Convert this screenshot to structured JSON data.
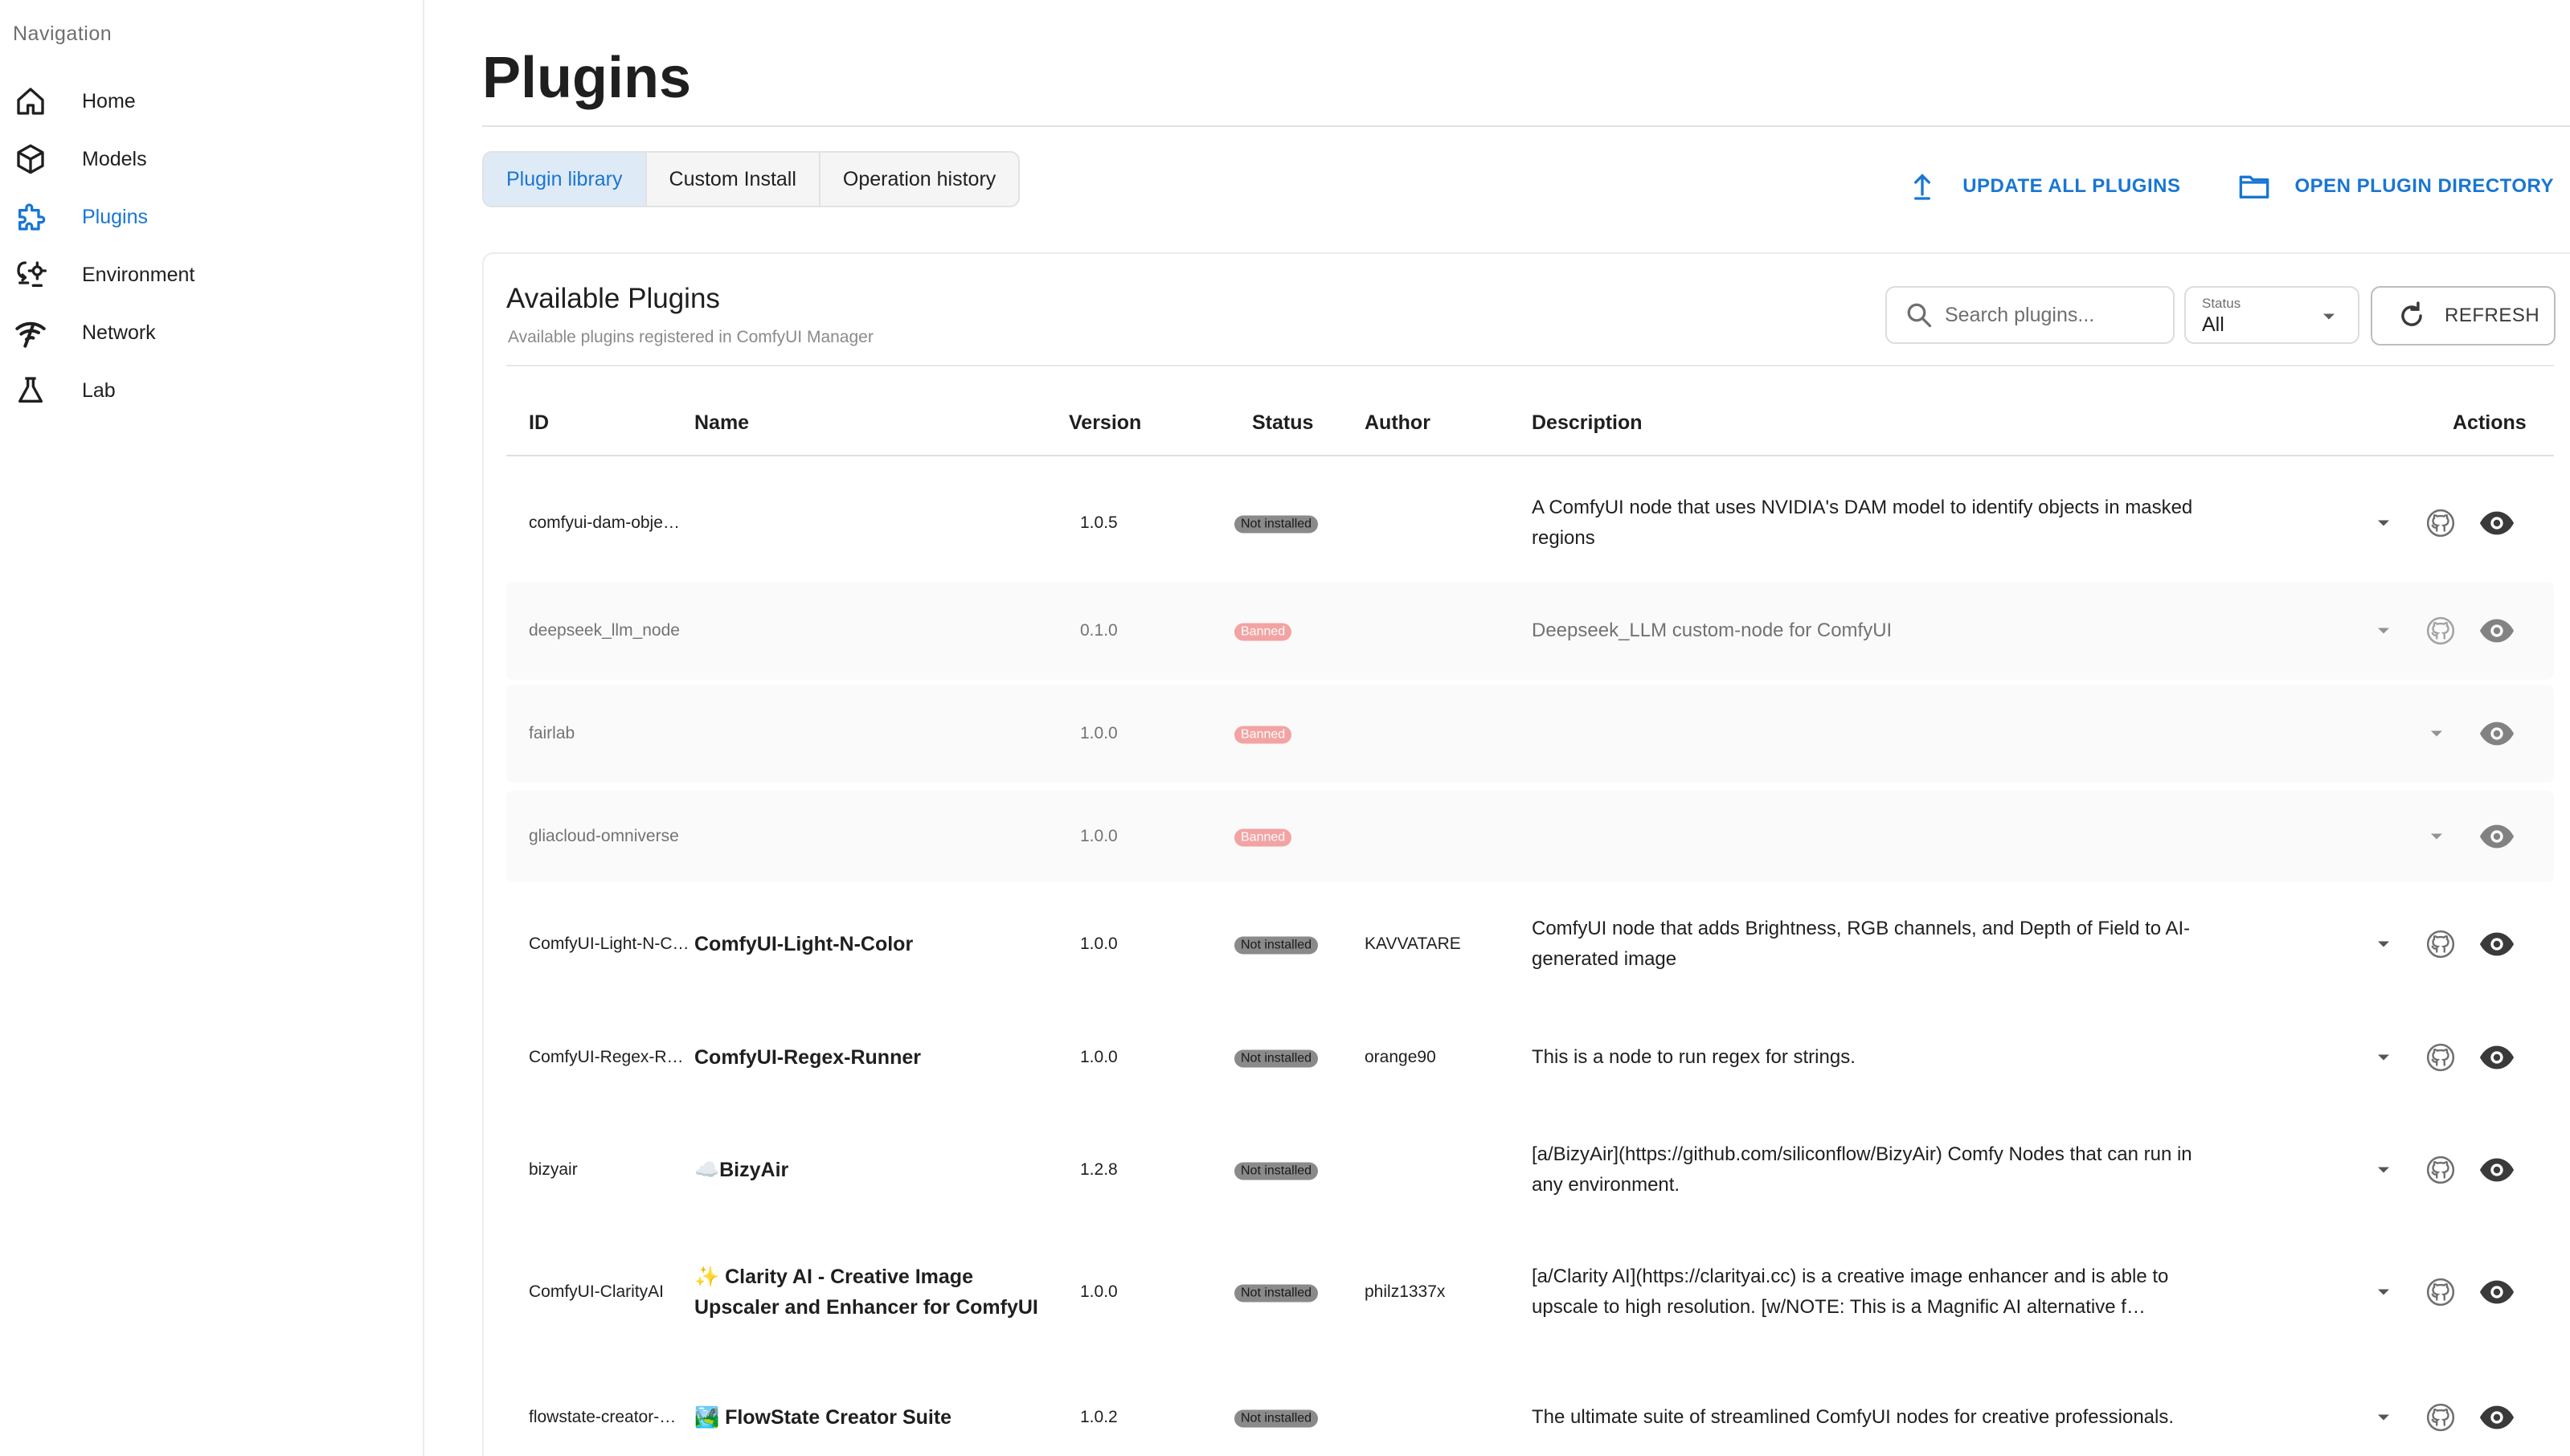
{
  "sidebar": {
    "heading": "Navigation",
    "items": [
      {
        "label": "Home",
        "icon": "home-icon"
      },
      {
        "label": "Models",
        "icon": "cube-icon"
      },
      {
        "label": "Plugins",
        "icon": "puzzle-icon",
        "active": true
      },
      {
        "label": "Environment",
        "icon": "environment-icon"
      },
      {
        "label": "Network",
        "icon": "network-icon"
      },
      {
        "label": "Lab",
        "icon": "flask-icon"
      }
    ]
  },
  "page": {
    "title": "Plugins"
  },
  "tabs": [
    {
      "label": "Plugin library",
      "active": true
    },
    {
      "label": "Custom Install"
    },
    {
      "label": "Operation history"
    }
  ],
  "actions": {
    "update_all": "UPDATE ALL PLUGINS",
    "open_dir": "OPEN PLUGIN DIRECTORY"
  },
  "card": {
    "title": "Available Plugins",
    "subtitle": "Available plugins registered in ComfyUI Manager",
    "search_placeholder": "Search plugins...",
    "status_label": "Status",
    "status_value": "All",
    "refresh": "REFRESH"
  },
  "table": {
    "headers": {
      "id": "ID",
      "name": "Name",
      "version": "Version",
      "status": "Status",
      "author": "Author",
      "description": "Description",
      "actions": "Actions"
    },
    "rows": [
      {
        "id": "comfyui-dam-obje…",
        "name": "",
        "version": "1.0.5",
        "status": "Not installed",
        "author": "",
        "description": "A ComfyUI node that uses NVIDIA's DAM model to identify objects in masked regions",
        "banned": false
      },
      {
        "id": "deepseek_llm_node",
        "name": "",
        "version": "0.1.0",
        "status": "Banned",
        "author": "",
        "description": "Deepseek_LLM custom-node for ComfyUI",
        "banned": true,
        "github": true
      },
      {
        "id": "fairlab",
        "name": "",
        "version": "1.0.0",
        "status": "Banned",
        "author": "",
        "description": "",
        "banned": true,
        "github": false
      },
      {
        "id": "gliacloud-omniverse",
        "name": "",
        "version": "1.0.0",
        "status": "Banned",
        "author": "",
        "description": "",
        "banned": true,
        "github": false
      },
      {
        "id": "ComfyUI-Light-N-C…",
        "name": "ComfyUI-Light-N-Color",
        "version": "1.0.0",
        "status": "Not installed",
        "author": "KAVVATARE",
        "description": "ComfyUI node that adds Brightness, RGB channels, and Depth of Field to AI-generated image",
        "banned": false
      },
      {
        "id": "ComfyUI-Regex-Ru…",
        "name": "ComfyUI-Regex-Runner",
        "version": "1.0.0",
        "status": "Not installed",
        "author": "orange90",
        "description": "This is a node to run regex for strings.",
        "banned": false
      },
      {
        "id": "bizyair",
        "name": "☁️BizyAir",
        "version": "1.2.8",
        "status": "Not installed",
        "author": "",
        "description": "[a/BizyAir](https://github.com/siliconflow/BizyAir) Comfy Nodes that can run in any environment.",
        "banned": false
      },
      {
        "id": "ComfyUI-ClarityAI",
        "name": "✨ Clarity AI - Creative Image Upscaler and Enhancer for ComfyUI",
        "version": "1.0.0",
        "status": "Not installed",
        "author": "philz1337x",
        "description": "[a/Clarity AI](https://clarityai.cc) is a creative image enhancer and is able to upscale to high resolution. [w/NOTE: This is a Magnific AI alternative f…",
        "banned": false
      },
      {
        "id": "flowstate-creator-…",
        "name": "🏞️ FlowState Creator Suite",
        "version": "1.0.2",
        "status": "Not installed",
        "author": "",
        "description": "The ultimate suite of streamlined ComfyUI nodes for creative professionals.",
        "banned": false
      }
    ]
  },
  "colors": {
    "accent": "#1976d2",
    "banned": "#ef6f6f",
    "not_installed": "#8a8a8a"
  }
}
